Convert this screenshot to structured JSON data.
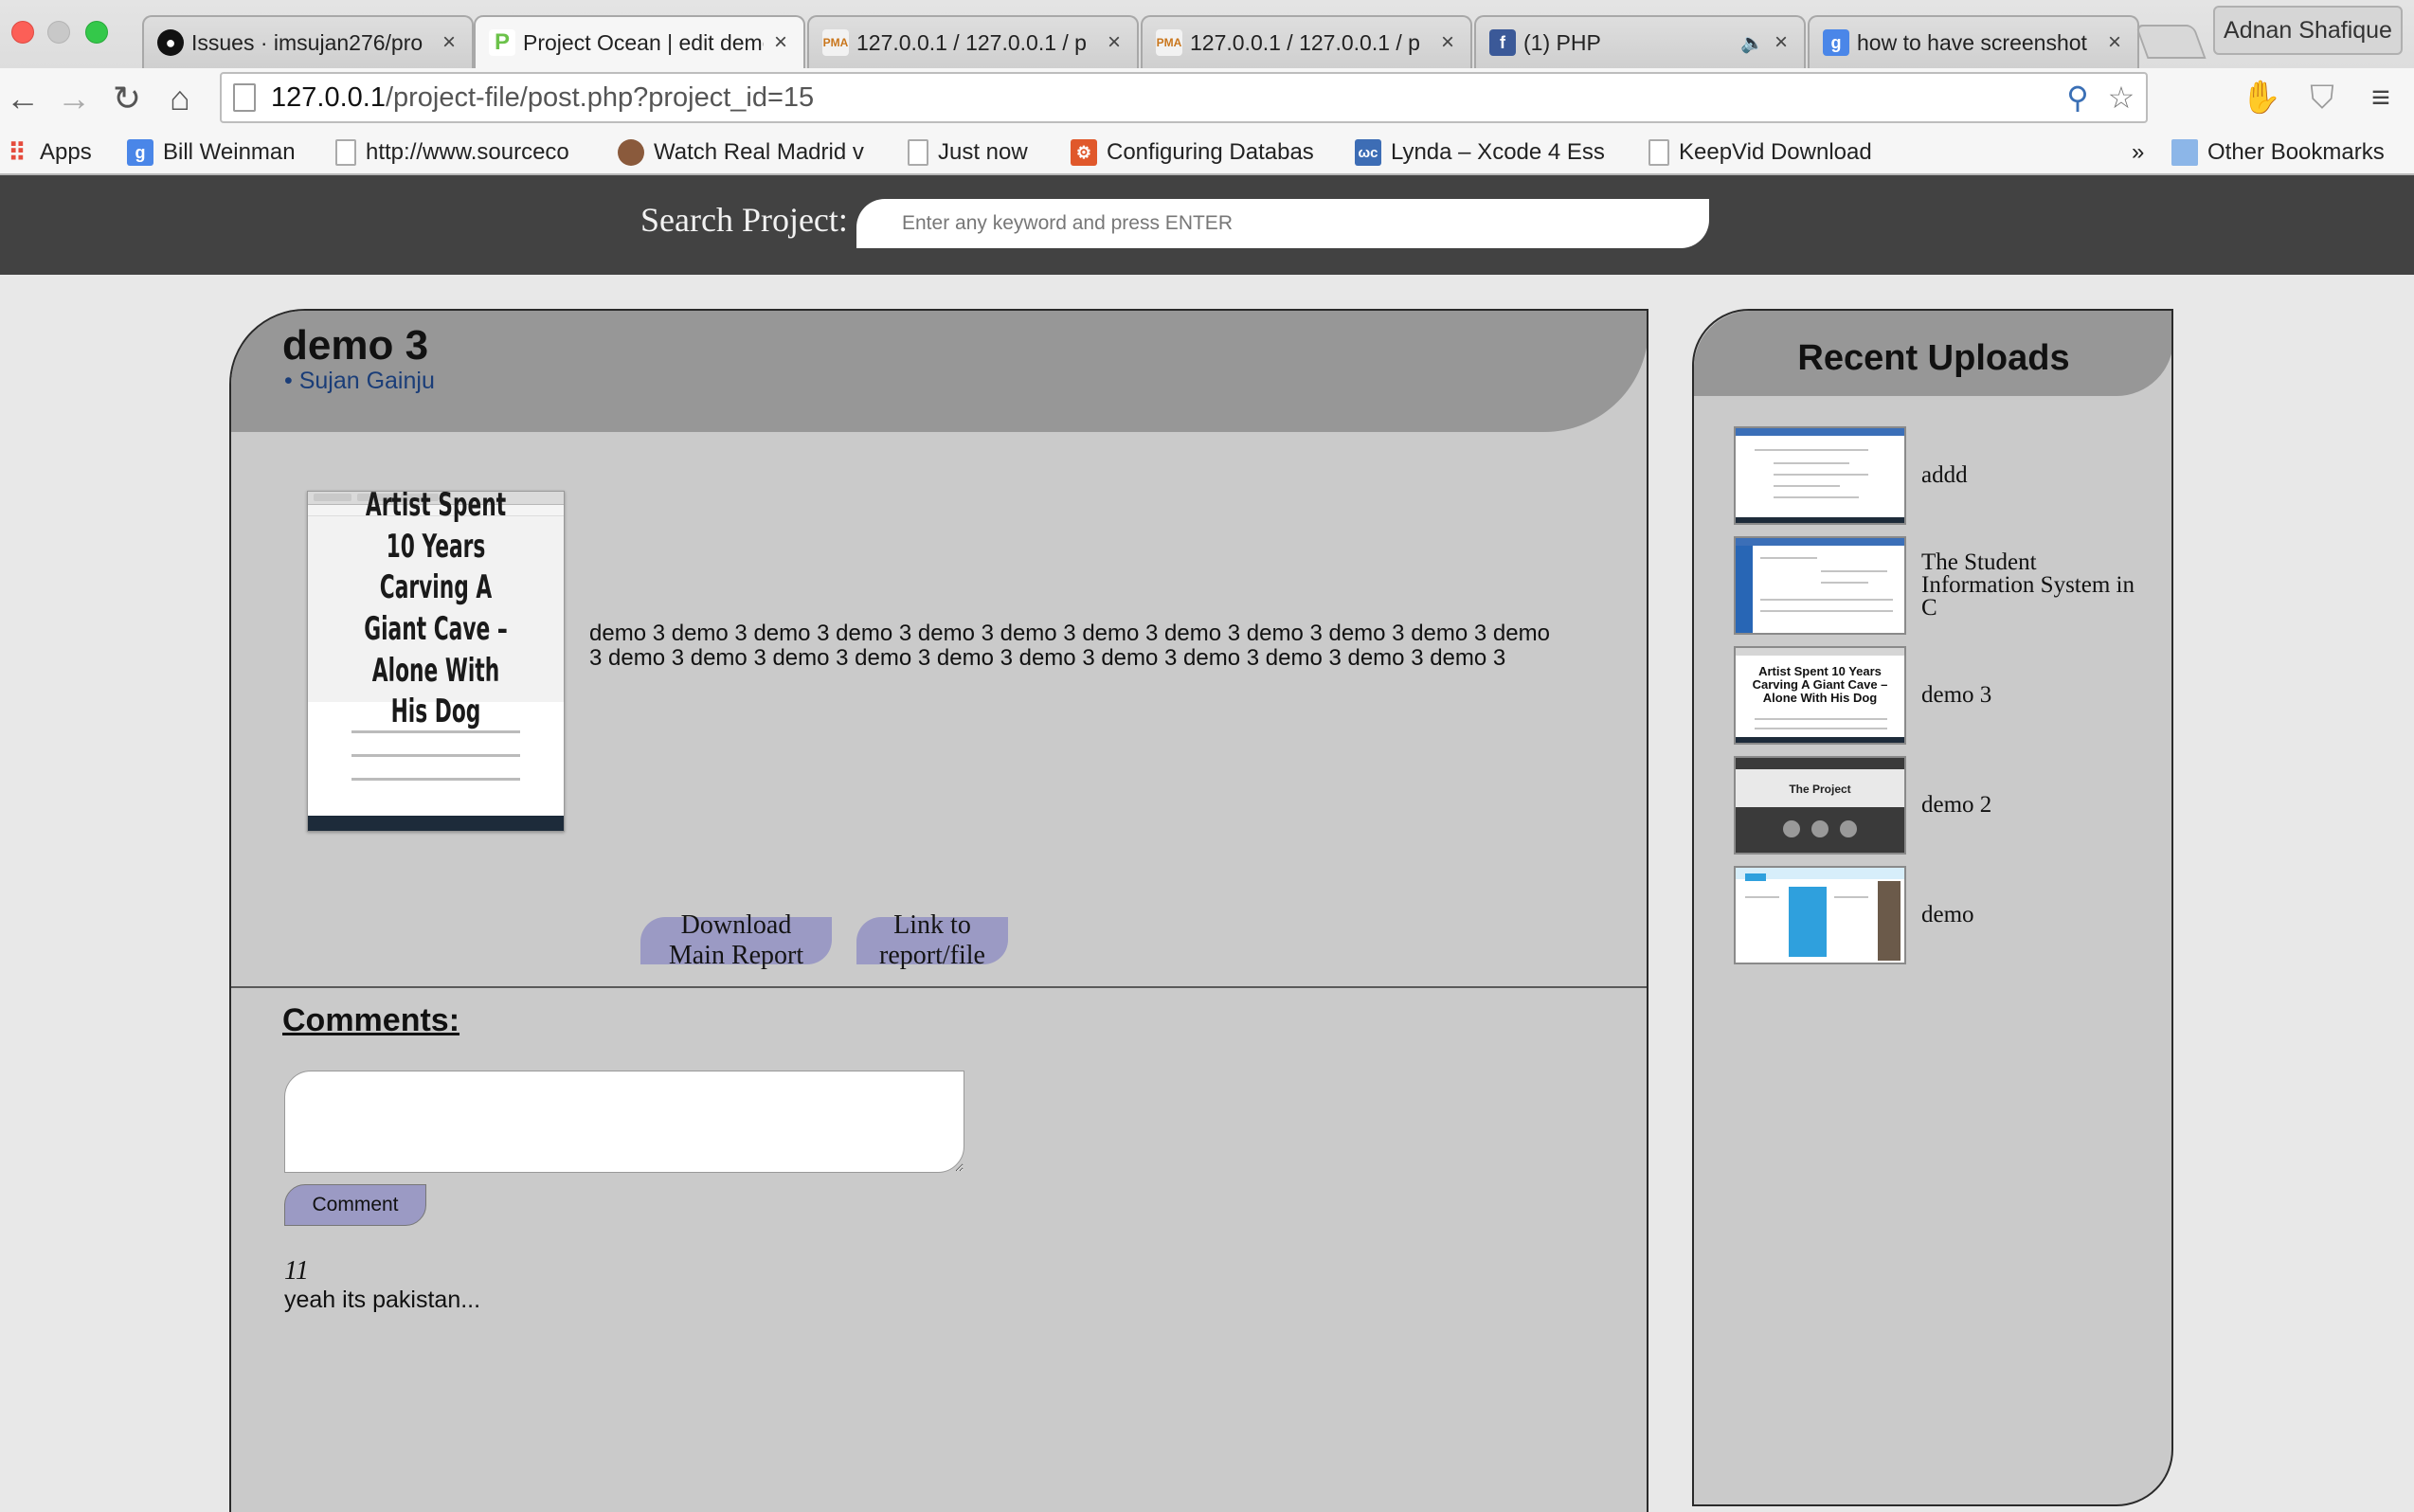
{
  "browser": {
    "tabs": [
      {
        "title": "Issues · imsujan276/pro",
        "icon": "github-icon"
      },
      {
        "title": "Project Ocean | edit demo",
        "icon": "project-ocean-icon"
      },
      {
        "title": "127.0.0.1 / 127.0.0.1 / p",
        "icon": "phpmyadmin-icon"
      },
      {
        "title": "127.0.0.1 / 127.0.0.1 / p",
        "icon": "phpmyadmin-icon"
      },
      {
        "title": "(1) PHP",
        "icon": "facebook-icon"
      },
      {
        "title": "how to have screenshot",
        "icon": "google-icon"
      }
    ],
    "profile_name": "Adnan Shafique",
    "url_host": "127.0.0.1",
    "url_path": "/project-file/post.php?project_id=15",
    "bookmarks": [
      {
        "label": "Apps",
        "icon": "apps-grid-icon"
      },
      {
        "label": "Bill Weinman",
        "icon": "google-icon"
      },
      {
        "label": "http://www.sourceco",
        "icon": "page-icon"
      },
      {
        "label": "Watch Real Madrid v",
        "icon": "avatar-icon"
      },
      {
        "label": "Just now",
        "icon": "page-icon"
      },
      {
        "label": "Configuring Databas",
        "icon": "configure-icon"
      },
      {
        "label": "Lynda – Xcode 4 Ess",
        "icon": "lynda-icon"
      },
      {
        "label": "KeepVid Download",
        "icon": "page-icon"
      }
    ],
    "bookmarks_overflow": "»",
    "other_bookmarks": "Other Bookmarks"
  },
  "site": {
    "search_label": "Search Project:",
    "search_placeholder": "Enter any keyword and press ENTER"
  },
  "post": {
    "title": "demo 3",
    "author": "• Sujan Gainju",
    "thumbnail_headline": "Artist Spent 10 Years Carving A Giant Cave – Alone With His Dog",
    "description": "demo 3 demo 3 demo 3 demo 3 demo 3 demo 3 demo 3 demo 3 demo 3 demo 3 demo 3 demo 3 demo 3 demo 3 demo 3 demo 3 demo 3 demo 3 demo 3 demo 3 demo 3 demo 3 demo 3",
    "download_button": "Download Main Report",
    "link_button": "Link to report/file"
  },
  "comments": {
    "heading": "Comments:",
    "submit_button": "Comment",
    "items": [
      {
        "author": "11",
        "text": "yeah its pakistan..."
      }
    ]
  },
  "sidebar": {
    "title": "Recent Uploads",
    "items": [
      {
        "label": "addd"
      },
      {
        "label": "The Student Information System in C"
      },
      {
        "label": "demo 3",
        "thumb_headline": "Artist Spent 10 Years Carving A Giant Cave – Alone With His Dog"
      },
      {
        "label": "demo 2",
        "thumb_headline": "The Project"
      },
      {
        "label": "demo"
      }
    ]
  },
  "colors": {
    "site_header": "#424242",
    "panel_bg": "#cacaca",
    "panel_head": "#979797",
    "button": "#9b9ac4",
    "author_link": "#1a3d78"
  }
}
